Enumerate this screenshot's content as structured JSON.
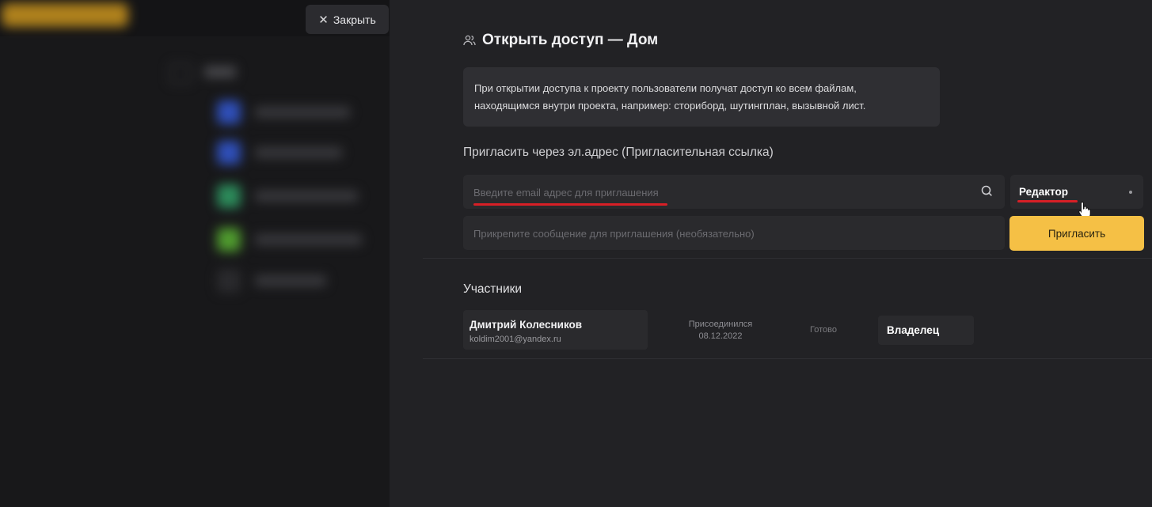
{
  "background_app": {
    "close_label": "Закрыть",
    "accent_color": "#e3a51f"
  },
  "share_panel": {
    "title": "Открыть доступ — Дом",
    "title_icon": "users-icon",
    "notice": {
      "line1": "При открытии доступа к проекту пользователи получат доступ ко всем файлам,",
      "line2": "находящимся внутри проекта, например: сториборд, шутингплан, вызывной лист."
    },
    "invite_section_label": "Пригласить через эл.адрес (Пригласительная ссылка)",
    "email_input": {
      "value": "",
      "placeholder": "Введите email адрес для приглашения"
    },
    "role_select": {
      "selected": "Редактор"
    },
    "message_input": {
      "value": "",
      "placeholder": "Прикрепите сообщение для приглашения (необязательно)"
    },
    "invite_button_label": "Пригласить",
    "invite_button_color": "#f5c045",
    "annotation_color": "#d81f26",
    "members_label": "Участники",
    "members": [
      {
        "name": "Дмитрий Колесников",
        "email": "koldim2001@yandex.ru",
        "joined_label": "Присоединился",
        "joined_date": "08.12.2022",
        "status": "Готово",
        "role": "Владелец"
      }
    ]
  }
}
